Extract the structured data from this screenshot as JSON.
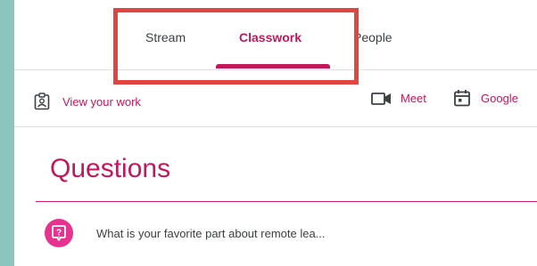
{
  "tabs": [
    {
      "label": "Stream",
      "active": false
    },
    {
      "label": "Classwork",
      "active": true
    },
    {
      "label": "People",
      "active": false
    }
  ],
  "toolbar": {
    "view_work": "View your work",
    "meet": "Meet",
    "calendar": "Google"
  },
  "section": {
    "title": "Questions"
  },
  "question": {
    "text": "What is your favorite part about remote lea..."
  },
  "colors": {
    "accent": "#c2185b",
    "highlight_box": "#e0463f",
    "background": "#8cc5bd"
  }
}
